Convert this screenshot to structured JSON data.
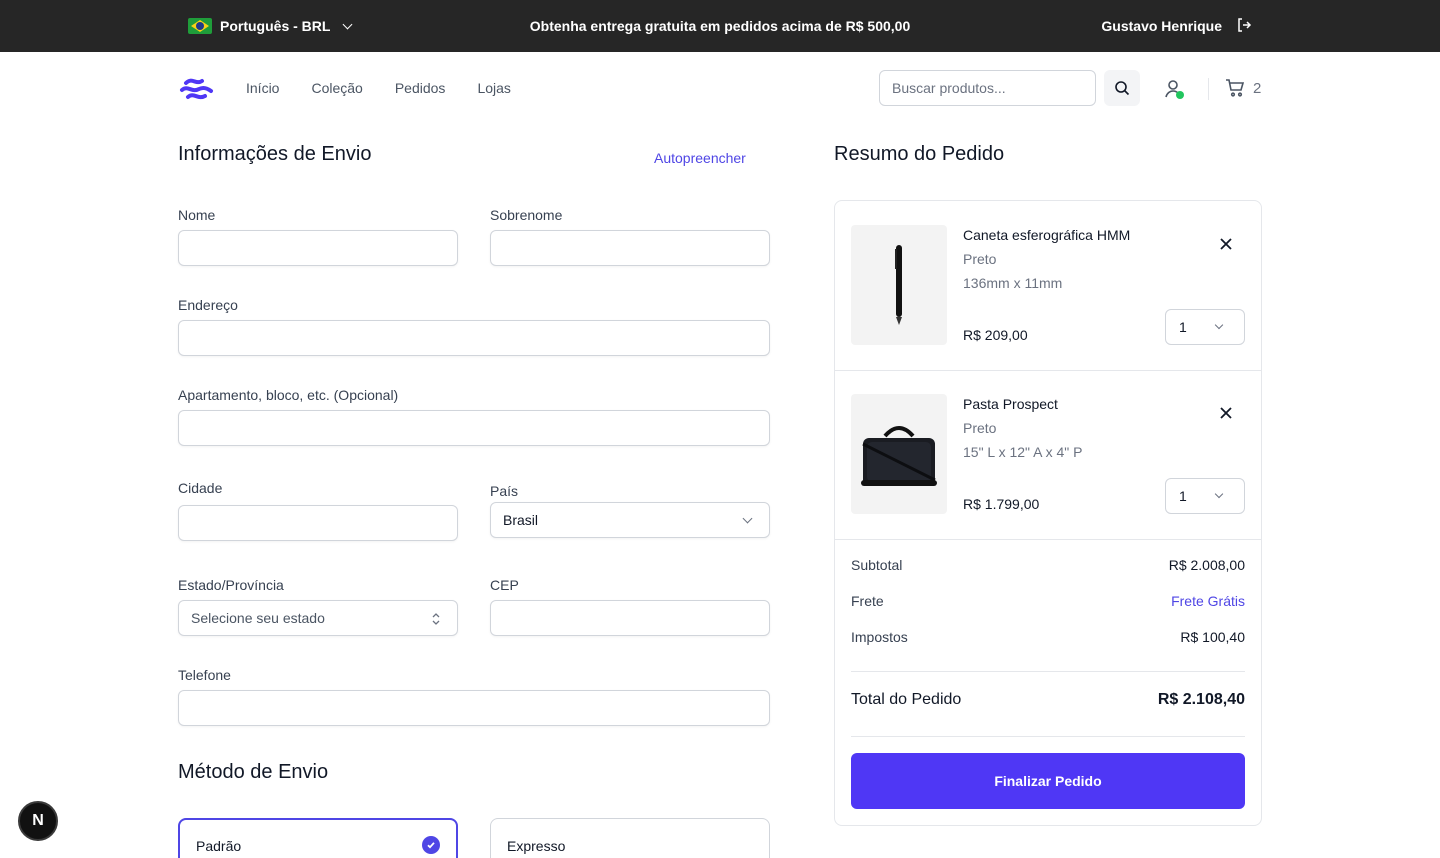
{
  "topbar": {
    "language": "Português - BRL",
    "promo": "Obtenha entrega gratuita em pedidos acima de R$ 500,00",
    "user_name": "Gustavo Henrique"
  },
  "header": {
    "nav": [
      "Início",
      "Coleção",
      "Pedidos",
      "Lojas"
    ],
    "search_placeholder": "Buscar produtos...",
    "cart_count": "2"
  },
  "shipping_form": {
    "title": "Informações de Envio",
    "autofill_label": "Autopreencher",
    "first_name_label": "Nome",
    "last_name_label": "Sobrenome",
    "address_label": "Endereço",
    "apartment_label": "Apartamento, bloco, etc. (Opcional)",
    "city_label": "Cidade",
    "country_label": "País",
    "country_value": "Brasil",
    "state_label": "Estado/Província",
    "state_placeholder": "Selecione seu estado",
    "zip_label": "CEP",
    "phone_label": "Telefone"
  },
  "shipping_method": {
    "title": "Método de Envio",
    "options": [
      "Padrão",
      "Expresso"
    ],
    "selected": "Padrão"
  },
  "summary": {
    "title": "Resumo do Pedido",
    "items": [
      {
        "name": "Caneta esferográfica HMM",
        "color": "Preto",
        "size": "136mm x 11mm",
        "price": "R$ 209,00",
        "qty": "1"
      },
      {
        "name": "Pasta Prospect",
        "color": "Preto",
        "size": "15\" L x 12\" A x 4\" P",
        "price": "R$ 1.799,00",
        "qty": "1"
      }
    ],
    "subtotal_label": "Subtotal",
    "subtotal": "R$ 2.008,00",
    "shipping_label": "Frete",
    "shipping": "Frete Grátis",
    "taxes_label": "Impostos",
    "taxes": "R$ 100,40",
    "total_label": "Total do Pedido",
    "total": "R$ 2.108,40",
    "checkout_label": "Finalizar Pedido"
  },
  "dev_badge": "N",
  "colors": {
    "accent": "#4f37f5",
    "link": "#4f46e5",
    "topbar": "#262626"
  }
}
